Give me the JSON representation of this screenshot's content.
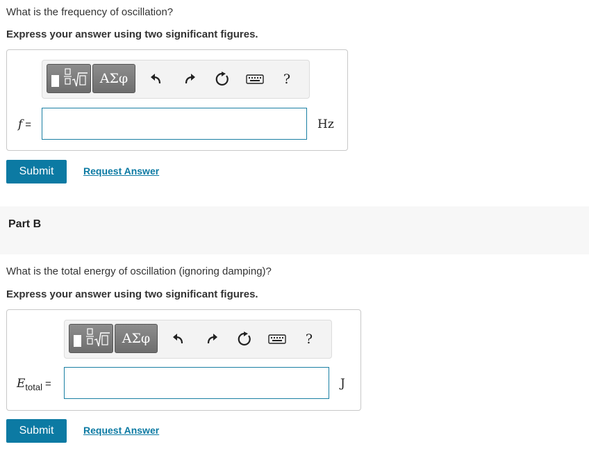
{
  "partA": {
    "question": "What is the frequency of oscillation?",
    "instruction": "Express your answer using two significant figures.",
    "toolbar": {
      "template_icon": "fraction-sqrt-template-icon",
      "greek_label": "ΑΣφ",
      "undo_icon": "undo-icon",
      "redo_icon": "redo-icon",
      "reset_icon": "reset-icon",
      "keyboard_icon": "keyboard-icon",
      "help_label": "?"
    },
    "variable": "f",
    "equals": "=",
    "input_value": "",
    "unit": "Hz",
    "submit_label": "Submit",
    "request_label": "Request Answer"
  },
  "partB": {
    "header": "Part B",
    "question": "What is the total energy of oscillation (ignoring damping)?",
    "instruction": "Express your answer using two significant figures.",
    "toolbar": {
      "template_icon": "fraction-sqrt-template-icon",
      "greek_label": "ΑΣφ",
      "undo_icon": "undo-icon",
      "redo_icon": "redo-icon",
      "reset_icon": "reset-icon",
      "keyboard_icon": "keyboard-icon",
      "help_label": "?"
    },
    "variable": "E",
    "variable_sub": "total",
    "equals": "=",
    "input_value": "",
    "unit": "J",
    "submit_label": "Submit",
    "request_label": "Request Answer"
  },
  "colors": {
    "accent": "#0c7aa3",
    "input_border": "#1a7fa3",
    "toolbar_bg": "#f3f3f3",
    "part_band": "#f7f7f7"
  }
}
